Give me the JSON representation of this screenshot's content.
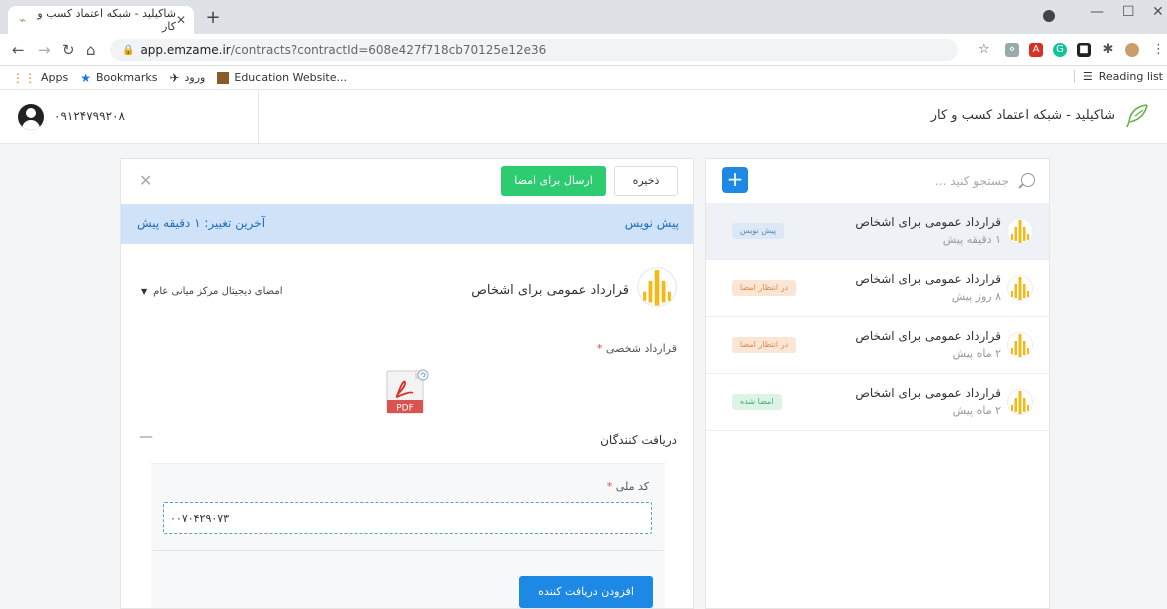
{
  "browser": {
    "tab_title": "شاکیلید - شبکه اعتماد کسب و کار",
    "url_host": "app.emzame.ir",
    "url_path": "/contracts?contractId=608e427f718cb70125e12e36",
    "bookmarks": [
      {
        "label": "Apps",
        "icon": "apps-grid-icon"
      },
      {
        "label": "Bookmarks",
        "icon": "star-icon"
      },
      {
        "label": "ورود",
        "icon": "bird-icon"
      },
      {
        "label": "Education Website...",
        "icon": "book-icon"
      }
    ],
    "reading_list": "Reading list"
  },
  "header": {
    "brand": "شاکیلید - شبکه اعتماد کسب و کار",
    "user_phone": "۰۹۱۲۴۷۹۹۲۰۸"
  },
  "list": {
    "search_placeholder": "جستجو کنید ...",
    "items": [
      {
        "title": "قرارداد عمومی برای اشخاص",
        "time": "۱ دقیقه پیش",
        "status": "پیش نویس",
        "status_bg": "#dce8f5",
        "status_color": "#5a86b8",
        "active": true
      },
      {
        "title": "قرارداد عمومی برای اشخاص",
        "time": "۸ روز پیش",
        "status": "در انتظار امضا",
        "status_bg": "#fbe6d6",
        "status_color": "#e0884a",
        "active": false
      },
      {
        "title": "قرارداد عمومی برای اشخاص",
        "time": "۲ ماه پیش",
        "status": "در انتظار امضا",
        "status_bg": "#fbe6d6",
        "status_color": "#e0884a",
        "active": false
      },
      {
        "title": "قرارداد عمومی برای اشخاص",
        "time": "۲ ماه پیش",
        "status": "امضا شده",
        "status_bg": "#dcf3e6",
        "status_color": "#3fae6d",
        "active": false
      }
    ]
  },
  "editor": {
    "send_label": "ارسال برای امضا",
    "save_label": "ذخیره",
    "status": "پیش نویس",
    "last_change": "آخرین تغییر: ۱ دقیقه پیش",
    "contract_title": "قرارداد عمومی برای اشخاص",
    "signature_type": "امضای دیجیتال مرکز میانی عام",
    "personal_contract_label": "قرارداد شخصی",
    "pdf_label": "PDF",
    "recipients_title": "دریافت کنندگان",
    "national_id_label": "کد ملی",
    "national_id_value": "۰۰۷۰۴۲۹۰۷۳",
    "add_recipient_label": "افزودن دریافت کننده"
  },
  "colors": {
    "primary": "#1e88e5",
    "success": "#2ecc71",
    "info_bg": "#cfe2f7"
  }
}
